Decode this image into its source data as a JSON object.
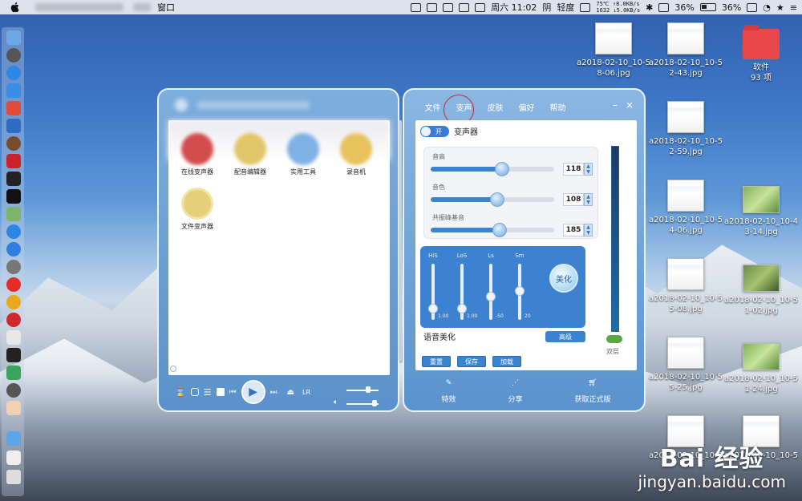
{
  "menubar": {
    "menu_item": "窗口",
    "temp_net": "75℃ ↑8.0KB/s",
    "temp_net2": "1632 ↓5.0KB/s",
    "datetime": "周六 11:02",
    "weather": "阴",
    "air": "轻度",
    "battery1": "36%",
    "battery2": "36%"
  },
  "desktop": {
    "files": [
      {
        "name": "a2018-02-10_10-58-06.jpg",
        "l1": "a2018-02-10_10-5",
        "l2": "8-06.jpg"
      },
      {
        "name": "a2018-02-10_10-52-43.jpg",
        "l1": "a2018-02-10_10-5",
        "l2": "2-43.jpg"
      },
      {
        "name": "软件",
        "l1": "软件",
        "l2": "93 项"
      },
      {
        "name": "a2018-02-10_10-52-59.jpg",
        "l1": "a2018-02-10_10-5",
        "l2": "2-59.jpg"
      },
      {
        "name": "a2018-02-10_10-54-06.jpg",
        "l1": "a2018-02-10_10-5",
        "l2": "4-06.jpg"
      },
      {
        "name": "a2018-02-10_10-43-14.jpg",
        "l1": "a2018-02-10_10-4",
        "l2": "3-14.jpg"
      },
      {
        "name": "a2018-02-10_10-55-08.jpg",
        "l1": "a2018-02-10_10-5",
        "l2": "5-08.jpg"
      },
      {
        "name": "a2018-02-10_10-51-02.jpg",
        "l1": "a2018-02-10_10-5",
        "l2": "1-02.jpg"
      },
      {
        "name": "a2018-02-10_10-55-25.jpg",
        "l1": "a2018-02-10_10-5",
        "l2": "5-25.jpg"
      },
      {
        "name": "a2018-02-10_10-51-24.jpg",
        "l1": "a2018-02-10_10-5",
        "l2": "1-24.jpg"
      },
      {
        "name": "a2018-02-10_10-5",
        "l1": "a2018-02-10_10-5",
        "l2": ""
      },
      {
        "name": "a2018-02-10_10-5",
        "l1": "a2018-02-10_10-5",
        "l2": ""
      }
    ]
  },
  "watermark": {
    "logo": "Bai 经验",
    "url": "jingyan.baidu.com"
  },
  "player": {
    "tools": [
      {
        "label": "在线变声器",
        "color": "#d24e4e"
      },
      {
        "label": "配音编辑器",
        "color": "#e2c66a"
      },
      {
        "label": "实用工具",
        "color": "#7fb1e6"
      },
      {
        "label": "录音机",
        "color": "#e7c25d"
      },
      {
        "label": "文件变声器",
        "color": "#e5d079"
      }
    ],
    "lr_label": "LR"
  },
  "fx": {
    "tabs": [
      "文件",
      "变声",
      "皮肤",
      "偏好",
      "帮助"
    ],
    "active_tab": "变声",
    "switch_label": "开",
    "title": "变声器",
    "sliders": [
      {
        "label": "音高",
        "value": "118",
        "percent": 0.58
      },
      {
        "label": "音色",
        "value": "108",
        "percent": 0.54
      },
      {
        "label": "共振峰基音",
        "value": "185",
        "percent": 0.56
      }
    ],
    "eq": [
      {
        "label": "HiS",
        "value": "1.00",
        "level": 0.2
      },
      {
        "label": "LoS",
        "value": "1.00",
        "level": 0.2
      },
      {
        "label": "Ls",
        "value": "-50",
        "level": 0.42
      },
      {
        "label": "Sm",
        "value": "20",
        "level": 0.52
      }
    ],
    "beautify_label": "美化",
    "voice_label": "语音美化",
    "advanced_label": "高级",
    "buttons": [
      "重置",
      "保存",
      "加载"
    ],
    "layer_label": "双层",
    "footer": [
      {
        "label": "特效",
        "icon": "magic-wand-icon"
      },
      {
        "label": "分享",
        "icon": "share-icon"
      },
      {
        "label": "获取正式版",
        "icon": "cart-icon"
      }
    ],
    "win_minimize": "–",
    "win_close": "×"
  }
}
